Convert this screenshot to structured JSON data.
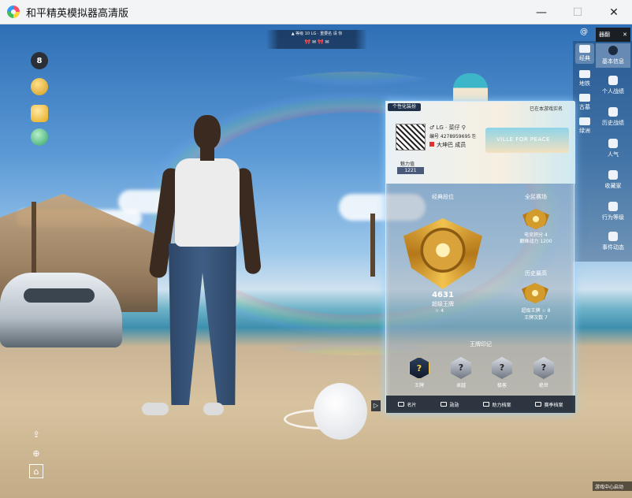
{
  "window": {
    "title": "和平精英模拟器高清版",
    "minimize": "—",
    "maximize": "☐",
    "close": "✕"
  },
  "top_hud": {
    "line1": "▲ 等级 10 LG · 重要名 请 你",
    "line2": "🎀 ✉    🎀 ✉"
  },
  "left_hud": {
    "mic_label": "8"
  },
  "right_sidebar": {
    "top_icon": "@",
    "top_badge": "器翻",
    "top_badge_close": "✕",
    "col_items": [
      {
        "label": "经典",
        "active": true
      },
      {
        "label": "地铁"
      },
      {
        "label": "古墓"
      },
      {
        "label": "绿洲"
      }
    ],
    "menu": [
      {
        "label": "基本信息",
        "active": true
      },
      {
        "label": "个人战绩"
      },
      {
        "label": "历史战绩"
      },
      {
        "label": "人气"
      },
      {
        "label": "收藏家"
      },
      {
        "label": "行为等级"
      },
      {
        "label": "事件动态"
      }
    ],
    "bottom_tag": "游戏中心启动"
  },
  "panel": {
    "tab": "个性化装扮",
    "status": "已在本游戏实名",
    "player_name": "♂ LG · 菜仔  ⚲",
    "player_id": "编号 4278959695  ⎘",
    "clan": "大坤巴 成员",
    "banner_text": "VILLE FOR PEACE",
    "charm_label": "魅力值",
    "charm_value": "1221",
    "classic_title": "经典段位",
    "score": "4631",
    "tier": "超级王牌",
    "stars": "☆ 4",
    "allpeople_title": "全民赛场",
    "allpeople_line1": "电竞积分 4",
    "allpeople_line2": "巅峰战力 1200",
    "history_title": "历史最高",
    "history_line1": "超级王牌 ☆ 8",
    "history_line2": "王牌次数 7",
    "marks_title": "王牌印记",
    "marks": [
      {
        "label": "王牌",
        "badge": "?"
      },
      {
        "label": "卓越",
        "badge": "?"
      },
      {
        "label": "极客",
        "badge": "?"
      },
      {
        "label": "绝世",
        "badge": "?"
      }
    ],
    "footer": [
      "名片",
      "勋勋",
      "助力档案",
      "赛季档案"
    ],
    "side_arrow": "▷"
  }
}
